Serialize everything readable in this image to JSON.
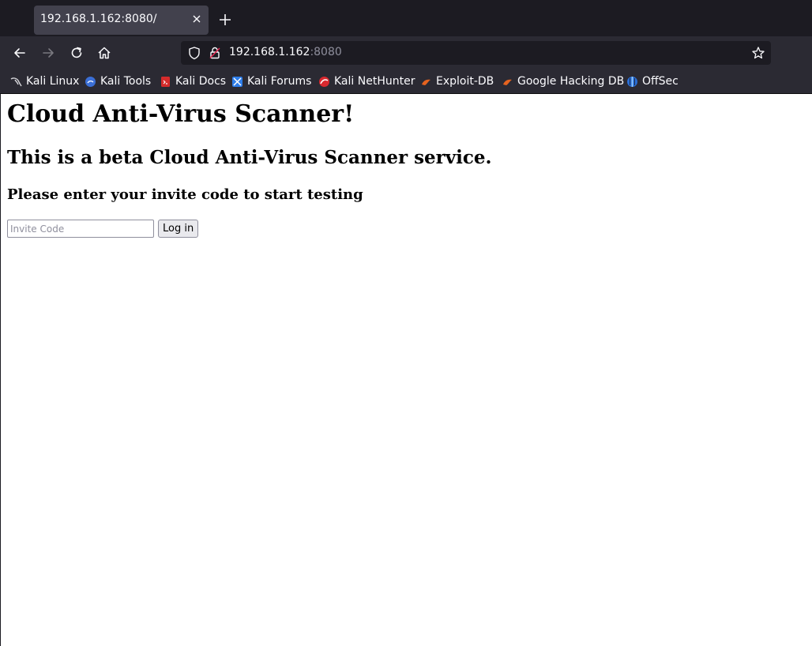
{
  "browser": {
    "tab": {
      "title": "192.168.1.162:8080/"
    },
    "url": {
      "host": "192.168.1.162",
      "port": ":8080"
    },
    "bookmarks": [
      {
        "label": "Kali Linux",
        "icon": "kali-dragon-icon"
      },
      {
        "label": "Kali Tools",
        "icon": "kali-tools-icon"
      },
      {
        "label": "Kali Docs",
        "icon": "kali-docs-icon"
      },
      {
        "label": "Kali Forums",
        "icon": "kali-forums-icon"
      },
      {
        "label": "Kali NetHunter",
        "icon": "kali-nethunter-icon"
      },
      {
        "label": "Exploit-DB",
        "icon": "exploit-db-icon"
      },
      {
        "label": "Google Hacking DB",
        "icon": "google-hacking-db-icon"
      },
      {
        "label": "OffSec",
        "icon": "offsec-icon"
      }
    ],
    "colors": {
      "chrome_dark": "#1c1b22",
      "toolbar": "#2b2a33",
      "tab_active": "#42414d",
      "text_light": "#fbfbfe",
      "text_muted": "#8f8f9d"
    }
  },
  "page": {
    "heading": "Cloud Anti-Virus Scanner!",
    "subheading": "This is a beta Cloud Anti-Virus Scanner service.",
    "instruction": "Please enter your invite code to start testing",
    "form": {
      "invite_placeholder": "Invite Code",
      "invite_value": "",
      "login_label": "Log in"
    }
  }
}
